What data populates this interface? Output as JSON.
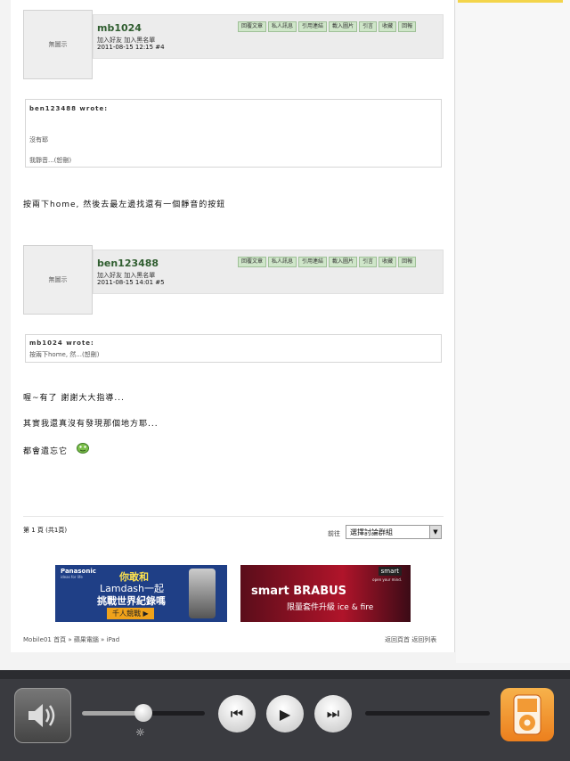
{
  "placeholder_avatar_label": "無圖示",
  "post_buttons": [
    "回覆文章",
    "私人訊息",
    "引用連結",
    "載入圖片",
    "引言",
    "收藏",
    "回報"
  ],
  "posts": [
    {
      "username": "mb1024",
      "user_links": "加入好友  加入黑名單",
      "datetime": "2011-08-15 12:15  #4",
      "quote_author": "ben123488 wrote:",
      "quote_lines": [
        "沒有耶",
        "我靜音...(恕刪)"
      ],
      "body_lines": [
        "按兩下home, 然後去最左邊找還有一個靜音的按鈕"
      ]
    },
    {
      "username": "ben123488",
      "user_links": "加入好友  加入黑名單",
      "datetime": "2011-08-15 14:01  #5",
      "quote_author": "mb1024 wrote:",
      "quote_lines": [
        "按兩下home, 然...(恕刪)"
      ],
      "body_lines": [
        "喔~有了 謝謝大大指導...",
        "其實我還真沒有發現那個地方耶...",
        "都會遺忘它"
      ]
    }
  ],
  "pagination": {
    "text": "第 1 頁 (共1頁)",
    "goto_label": "前往",
    "select_value": "選擇討論群組"
  },
  "ads": {
    "ad1": {
      "brand": "Panasonic",
      "tagline": "ideas for life",
      "line1": "你敢和",
      "line2": "Lamdash一起",
      "line3": "挑戰世界紀錄嗎",
      "cta": "千人競戰 ▶"
    },
    "ad2": {
      "brand": "smart",
      "tagline": "open your mind.",
      "title": "smart BRABUS",
      "subtitle": "限量套件升級  ice & fire"
    }
  },
  "footer": {
    "breadcrumb": "Mobile01 首頁 » 蘋果電腦 » iPad",
    "links": "返回頁首  返回列表"
  },
  "media_bar": {
    "volume_level": 0.5,
    "prev_icon": "⏮",
    "play_icon": "▶",
    "next_icon": "⏭",
    "brightness_icon": "☼"
  },
  "colors": {
    "username": "#2f5d2f",
    "button_bg": "#cfe6c9",
    "ipod_orange": "#ec7f1d"
  }
}
